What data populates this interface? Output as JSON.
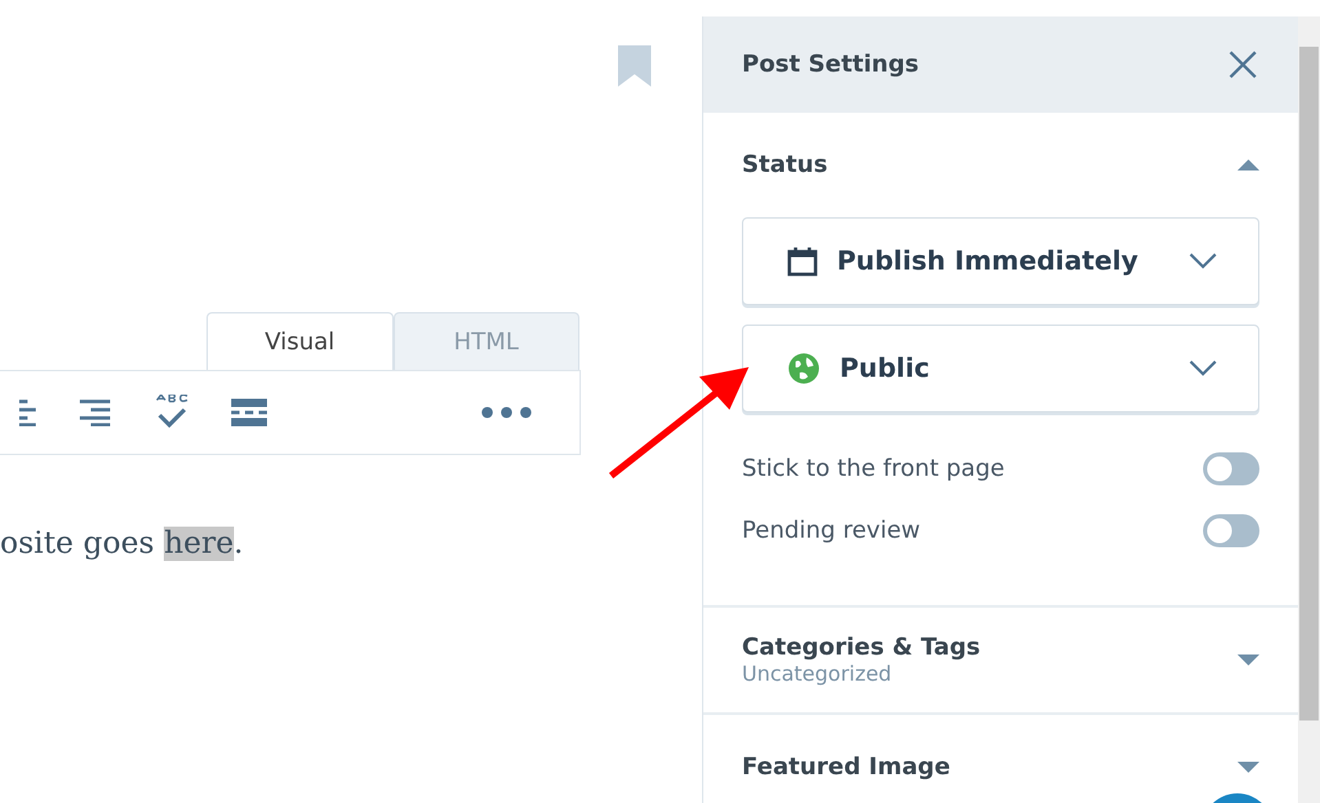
{
  "editor": {
    "tabs": [
      {
        "label": "Visual",
        "selected": true
      },
      {
        "label": "HTML",
        "selected": false
      }
    ],
    "body_text": {
      "before": "osite goes ",
      "highlighted": "here",
      "after": "."
    }
  },
  "sidebar": {
    "title": "Post Settings",
    "sections": [
      {
        "title": "Status",
        "expanded": true,
        "dropdowns": [
          {
            "kind": "calendar",
            "label": "Publish Immediately"
          },
          {
            "kind": "globe",
            "label": "Public"
          }
        ],
        "toggles": [
          {
            "label": "Stick to the front page",
            "on": false
          },
          {
            "label": "Pending review",
            "on": false
          }
        ]
      },
      {
        "title": "Categories & Tags",
        "subtitle": "Uncategorized",
        "expanded": false
      },
      {
        "title": "Featured Image",
        "expanded": false
      }
    ]
  }
}
